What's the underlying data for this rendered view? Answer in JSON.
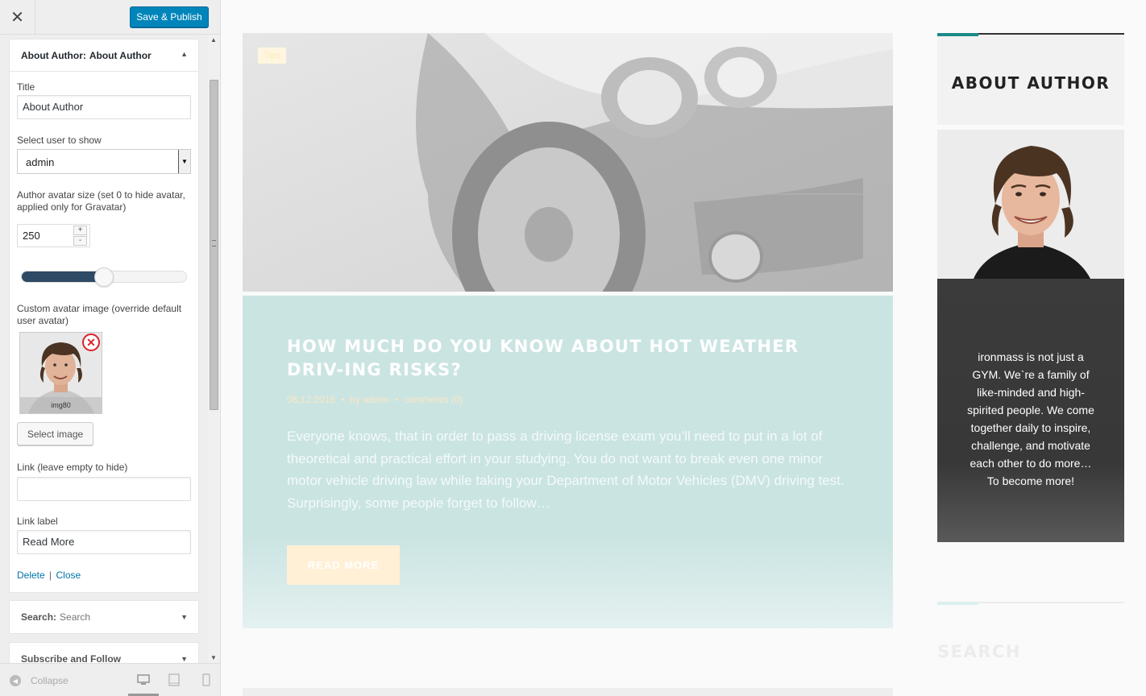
{
  "customizer": {
    "close_label": "✕",
    "publish_label": "Save & Publish",
    "widget_about": {
      "head_prefix": "About Author:",
      "head_name": "About Author",
      "title_label": "Title",
      "title_value": "About Author",
      "user_label": "Select user to show",
      "user_value": "admin",
      "avatar_size_label": "Author avatar size (set 0 to hide avatar, applied only for Gravatar)",
      "avatar_size_value": "250",
      "avatar_size_slider": 0.5,
      "custom_avatar_label": "Custom avatar image (override default user avatar)",
      "avatar_caption": "img80",
      "select_image_label": "Select image",
      "link_label": "Link (leave empty to hide)",
      "link_value": "",
      "link_label_label": "Link label",
      "link_label_value": "Read More",
      "delete_label": "Delete",
      "separator": "|",
      "close_link_label": "Close"
    },
    "widget_search": {
      "head_prefix": "Search:",
      "head_name": "Search"
    },
    "widget_subscribe": {
      "head_prefix": "Subscribe and Follow"
    },
    "footer": {
      "collapse_label": "Collapse"
    }
  },
  "preview": {
    "post": {
      "category": "Tips",
      "title": "How much do you know about hot weather driv-ing risks?",
      "date": "08.12.2016",
      "author": "by admin",
      "comments": "comments (0)",
      "excerpt": "Everyone knows, that in order to pass a driving license exam you’ll need to put in a lot of theoretical and practical effort in your studying. You do not want to break even one minor motor vehicle driving law while taking your Department of Motor Vehicles (DMV) driving test. Surprisingly, some people forget to follow…",
      "read_more": "READ MORE"
    },
    "about": {
      "title": "ABOUT AUTHOR",
      "bio": "ironmass is not just a GYM. We`re a family of like-minded and high-spirited people. We come together daily to inspire, challenge, and motivate each other to do more… To become more!"
    },
    "search": {
      "title": "SEARCH"
    }
  }
}
